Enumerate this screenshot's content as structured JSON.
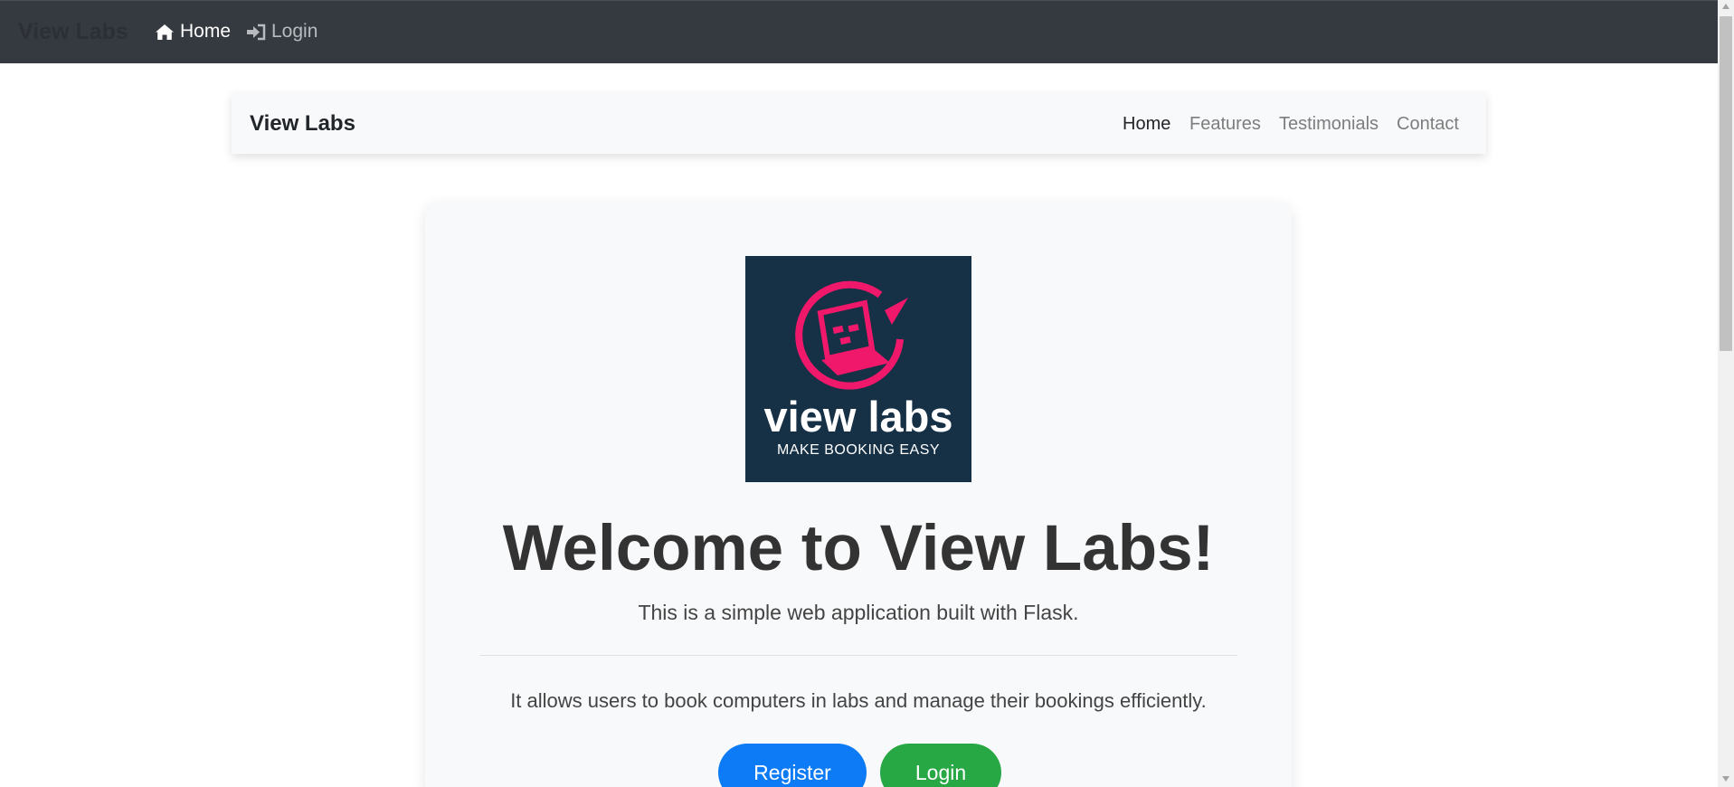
{
  "top_nav": {
    "brand": "View Labs",
    "home_label": "Home",
    "login_label": "Login"
  },
  "sub_nav": {
    "brand": "View Labs",
    "links": [
      "Home",
      "Features",
      "Testimonials",
      "Contact"
    ]
  },
  "hero": {
    "logo_main": "view labs",
    "logo_sub": "MAKE BOOKING EASY",
    "title": "Welcome to View Labs!",
    "lead": "This is a simple web application built with Flask.",
    "description": "It allows users to book computers in labs and manage their bookings efficiently.",
    "register_label": "Register",
    "login_label": "Login"
  },
  "colors": {
    "top_nav_bg": "#343a40",
    "sub_nav_bg": "#f8f9fa",
    "logo_bg": "#163046",
    "logo_accent": "#f0186a",
    "primary": "#0d7bf5",
    "success": "#28a745"
  },
  "icons": {
    "home": "home-icon",
    "login": "sign-in-icon"
  }
}
